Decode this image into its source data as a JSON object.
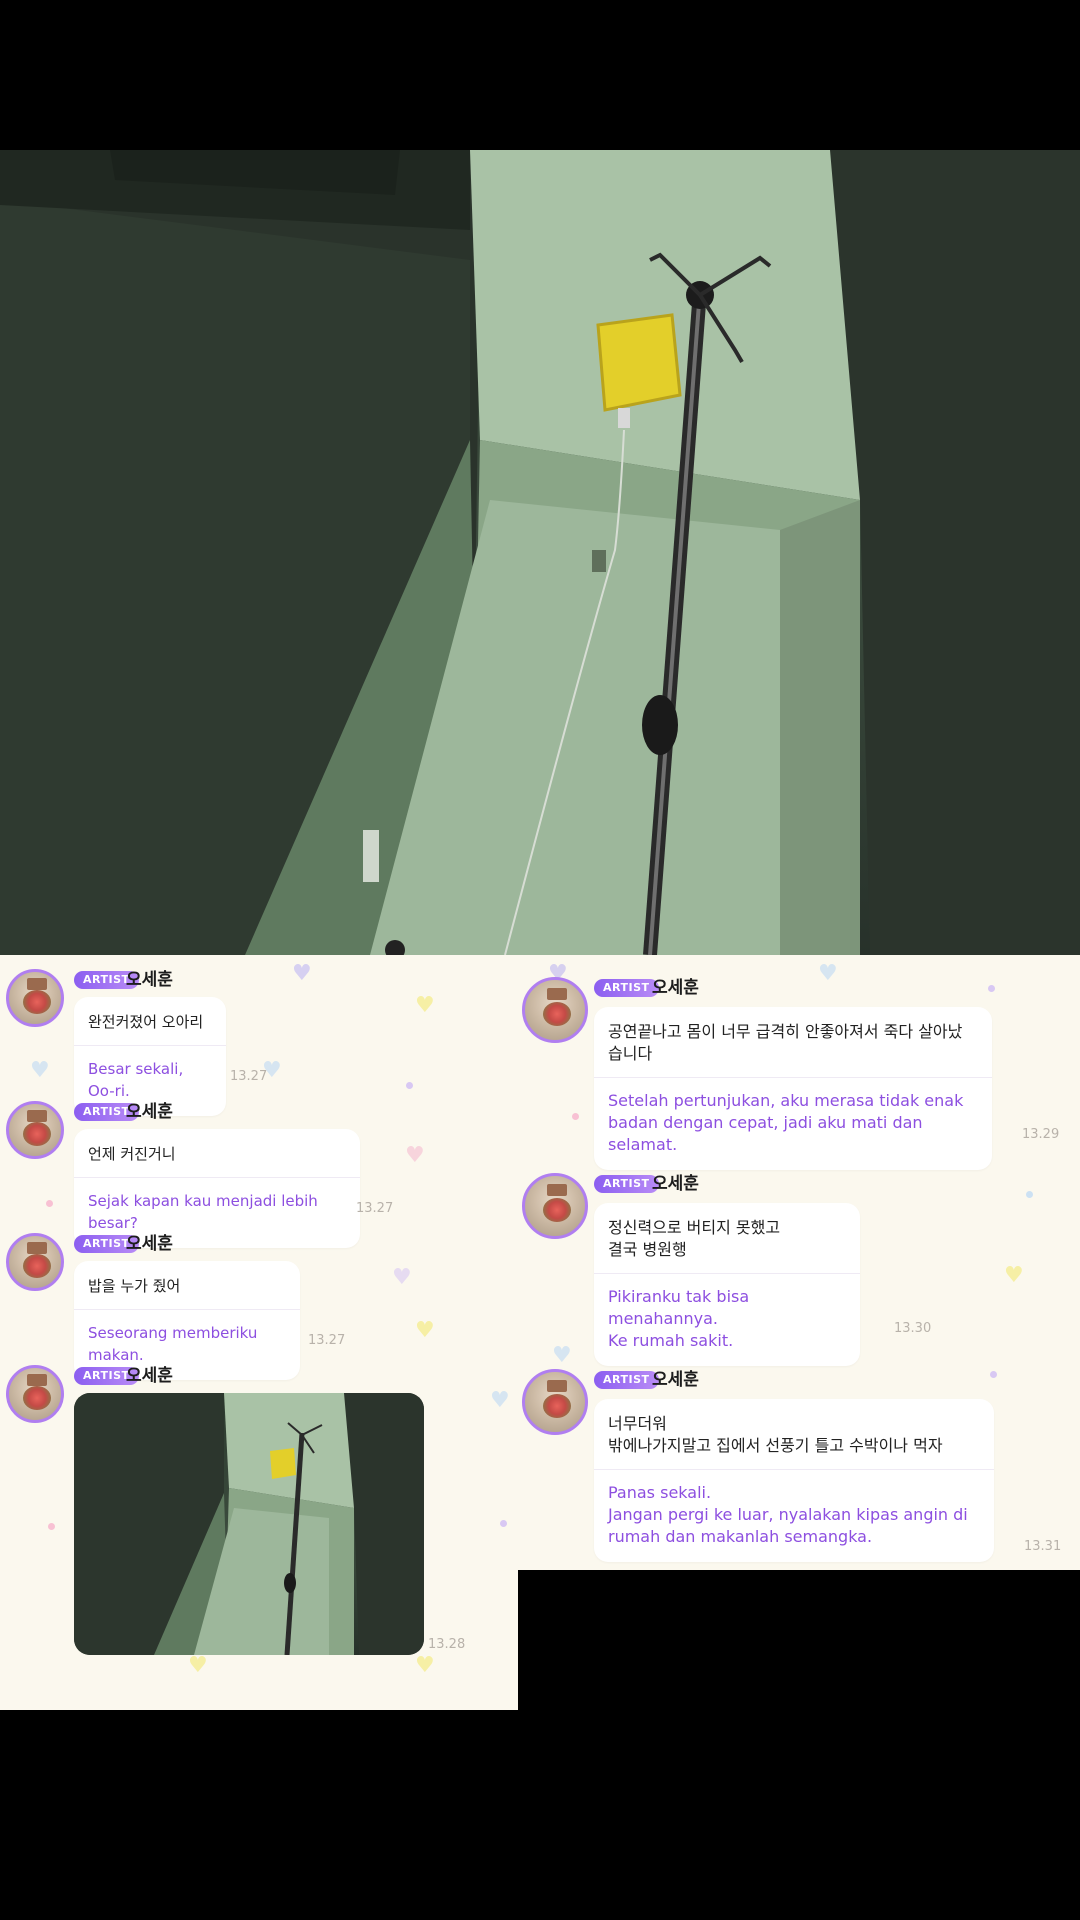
{
  "left_messages": [
    {
      "badge": "ARTIST",
      "name": "오세훈",
      "korean": "완전커졌어 오아리",
      "translation": "Besar sekali, Oo-ri.",
      "time": "13.27"
    },
    {
      "badge": "ARTIST",
      "name": "오세훈",
      "korean": "언제 커진거니",
      "translation": "Sejak kapan kau menjadi lebih besar?",
      "time": "13.27"
    },
    {
      "badge": "ARTIST",
      "name": "오세훈",
      "korean": "밥을 누가 줬어",
      "translation": "Seseorang memberiku makan.",
      "time": "13.27"
    },
    {
      "badge": "ARTIST",
      "name": "오세훈",
      "photo": "iv-pole-photo",
      "time": "13.28"
    }
  ],
  "right_messages": [
    {
      "badge": "ARTIST",
      "name": "오세훈",
      "korean": "공연끝나고 몸이 너무 급격히 안좋아져서 죽다 살아났\n습니다",
      "translation": "Setelah pertunjukan, aku merasa tidak enak\nbadan dengan cepat, jadi aku mati dan selamat.",
      "time": "13.29"
    },
    {
      "badge": "ARTIST",
      "name": "오세훈",
      "korean": "정신력으로 버티지 못했고\n결국 병원행",
      "translation": "Pikiranku tak bisa menahannya.\nKe rumah sakit.",
      "time": "13.30"
    },
    {
      "badge": "ARTIST",
      "name": "오세훈",
      "korean": "너무더워\n밖에나가지말고 집에서 선풍기 틀고 수박이나 먹자",
      "translation": "Panas sekali.\nJangan pergi ke luar, nyalakan kipas angin di\nrumah dan makanlah semangka.",
      "time": "13.31"
    }
  ],
  "colors": {
    "accent": "#8b5ef0",
    "translation_text": "#8d4fe0",
    "panel_bg": "#fbf8ee"
  }
}
